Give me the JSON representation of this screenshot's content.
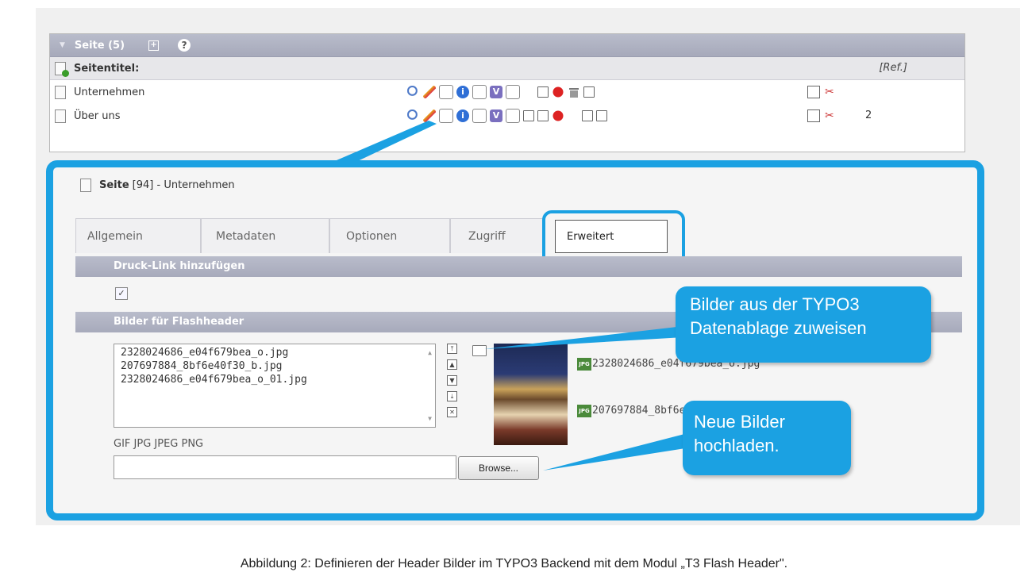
{
  "page_list": {
    "header_title": "Seite (5)",
    "title_label": "Seitentitel:",
    "ref_label": "[Ref.]",
    "rows": [
      {
        "title": "Unternehmen",
        "count": ""
      },
      {
        "title": "Über uns",
        "count": "2"
      }
    ]
  },
  "record": {
    "type": "Seite",
    "id_title": "[94] - Unternehmen"
  },
  "tabs": [
    {
      "label": "Allgemein"
    },
    {
      "label": "Metadaten"
    },
    {
      "label": "Optionen"
    },
    {
      "label": "Zugriff"
    },
    {
      "label": "Erweitert"
    }
  ],
  "active_tab": "Erweitert",
  "sections": {
    "print_link": "Druck-Link hinzufügen",
    "print_link_checked": "✓",
    "images": "Bilder für Flashheader"
  },
  "files": [
    "2328024686_e04f679bea_o.jpg",
    "207697884_8bf6e40f30_b.jpg",
    "2328024686_e04f679bea_o_01.jpg"
  ],
  "thumb_labels": [
    "2328024686_e04f679bea_o.jpg",
    "207697884_8bf6e40f30_b.jpg"
  ],
  "allowed_types": "GIF JPG JPEG PNG",
  "browse_label": "Browse...",
  "callouts": {
    "assign_line1": "Bilder aus der TYPO3",
    "assign_line2": "Datenablage zuweisen",
    "upload_line1": "Neue Bilder",
    "upload_line2": "hochladen."
  },
  "caption": "Abbildung 2: Definieren der Header Bilder im TYPO3 Backend mit dem Modul „T3 Flash Header\"."
}
